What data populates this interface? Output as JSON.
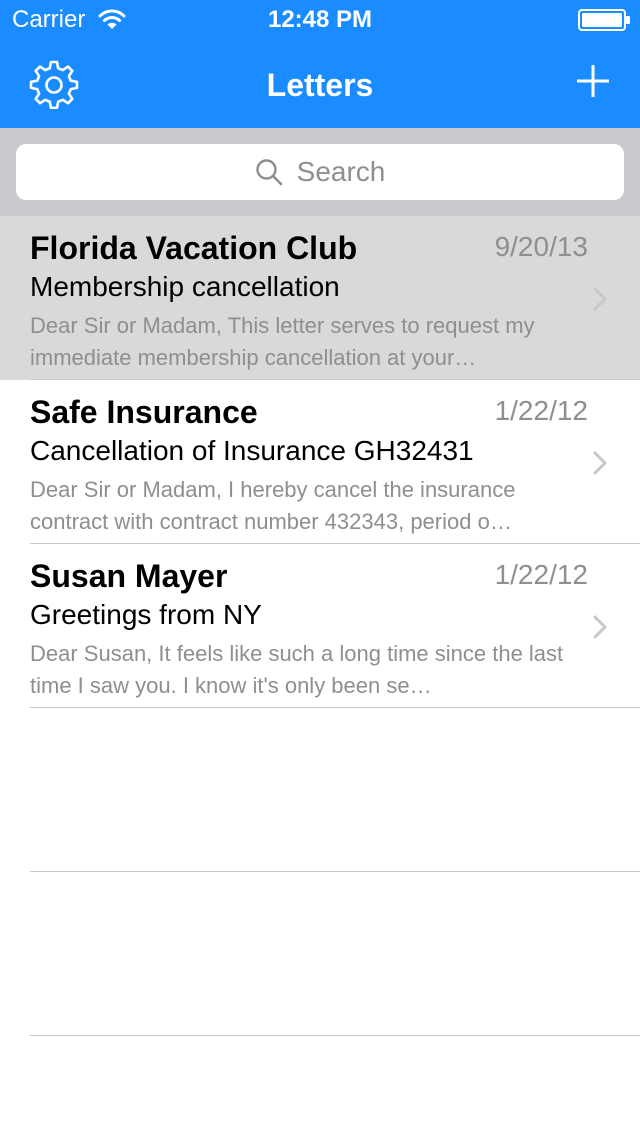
{
  "status_bar": {
    "carrier": "Carrier",
    "time": "12:48 PM",
    "wifi_icon": "wifi-icon",
    "battery_icon": "battery-icon"
  },
  "nav_bar": {
    "title": "Letters",
    "left_icon": "gear-icon",
    "right_icon": "plus-icon"
  },
  "search": {
    "placeholder": "Search",
    "icon": "search-icon"
  },
  "colors": {
    "accent": "#1a8cff",
    "selected_row": "#d9d9d9",
    "secondary_text": "#8e8e93",
    "search_bar_bg": "#c9c9ce"
  },
  "letters": [
    {
      "sender": "Florida Vacation Club",
      "date": "9/20/13",
      "subject": "Membership cancellation",
      "preview": "Dear Sir or Madam,  This letter serves to request my immediate membership cancellation at your…",
      "selected": true
    },
    {
      "sender": "Safe Insurance",
      "date": "1/22/12",
      "subject": "Cancellation of Insurance GH32431",
      "preview": "Dear Sir or Madam,  I hereby cancel the insurance contract with contract number 432343, period o…",
      "selected": false
    },
    {
      "sender": "Susan Mayer",
      "date": "1/22/12",
      "subject": "Greetings from NY",
      "preview": "Dear Susan,  It feels like such a long time since the last time I saw you. I know it's only been se…",
      "selected": false
    }
  ]
}
